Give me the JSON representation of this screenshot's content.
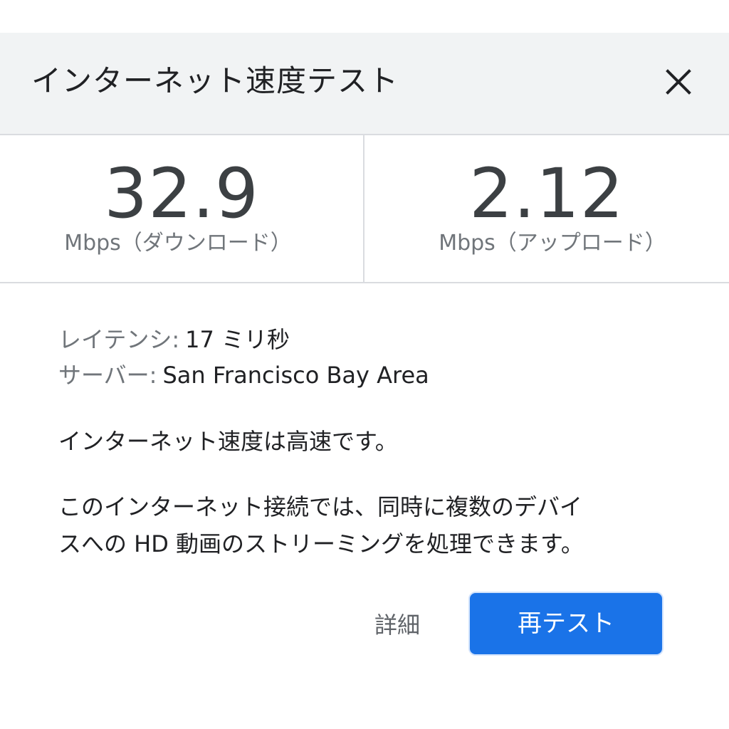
{
  "dialog": {
    "title": "インターネット速度テスト",
    "close_icon": "close-icon"
  },
  "download": {
    "value": "32.9",
    "unit_label": "Mbps（ダウンロード）"
  },
  "upload": {
    "value": "2.12",
    "unit_label": "Mbps（アップロード）"
  },
  "details": {
    "latency_label": "レイテンシ:",
    "latency_value": "17 ミリ秒",
    "server_label": "サーバー:",
    "server_value": "San Francisco Bay Area"
  },
  "summary": "インターネット速度は高速です。",
  "description_lines": [
    "このインターネット接続では、同時に複数のデバイ",
    "スへの HD 動画のストリーミングを処理できます。"
  ],
  "actions": {
    "details_label": "詳細",
    "retest_label": "再テスト"
  },
  "colors": {
    "header_bg": "#f1f3f4",
    "accent": "#1a73e8",
    "divider": "#dadce0",
    "secondary_text": "#70757a"
  }
}
